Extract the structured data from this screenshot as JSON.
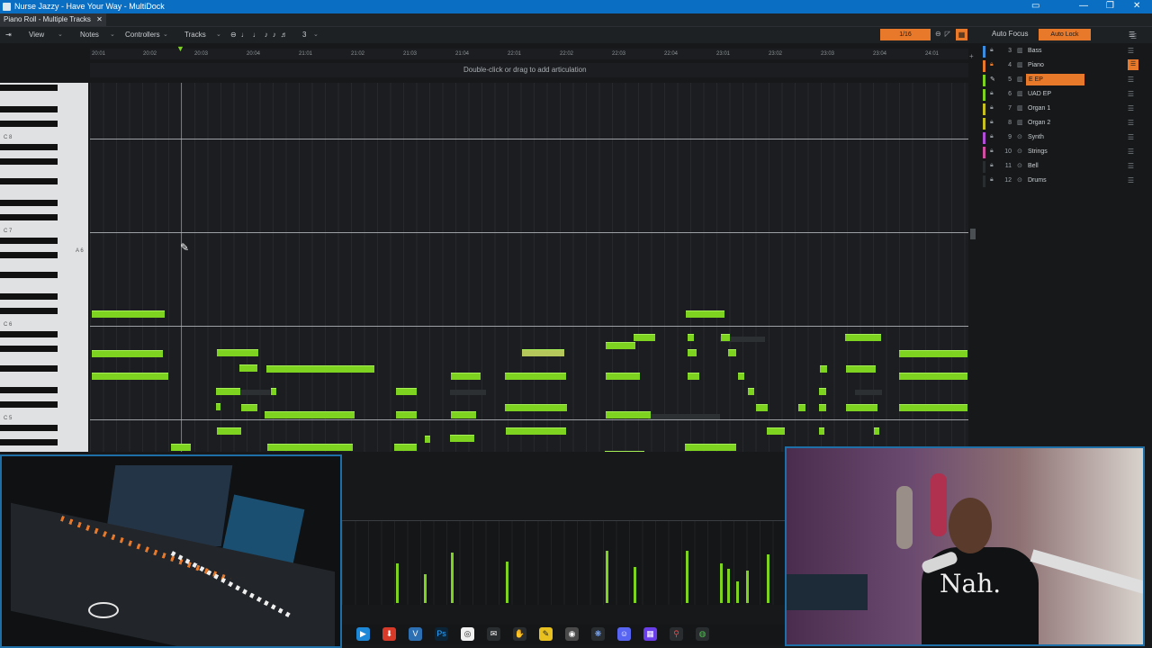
{
  "window": {
    "title": "Nurse Jazzy - Have Your Way - MultiDock"
  },
  "tabs": [
    {
      "label": "Piano Roll - Multiple Tracks"
    }
  ],
  "toolbar": {
    "view": "View",
    "notes": "Notes",
    "controllers": "Controllers",
    "tracks": "Tracks",
    "tool_number": "3",
    "snap": "1/16",
    "auto_focus": "Auto Focus",
    "auto_lock": "Auto Lock"
  },
  "ruler": {
    "markers": [
      "20:01",
      "20:02",
      "20:03",
      "20:04",
      "21:01",
      "21:02",
      "21:03",
      "21:04",
      "22:01",
      "22:02",
      "22:03",
      "22:04",
      "23:01",
      "23:02",
      "23:03",
      "23:04",
      "24:01"
    ]
  },
  "articulation_hint": "Double-click or drag to add articulation",
  "keyboard": {
    "octave_labels": [
      "C 8",
      "C 7",
      "C 6",
      "C 5"
    ],
    "hover_key": "A 6"
  },
  "track_list": [
    {
      "num": "3",
      "name": "Bass",
      "color": "#3b8de0",
      "icon": "instrument-icon"
    },
    {
      "num": "4",
      "name": "Piano",
      "color": "#e8792a",
      "icon": "instrument-icon"
    },
    {
      "num": "5",
      "name": "E EP",
      "color": "#7ed321",
      "icon": "instrument-icon",
      "selected": true
    },
    {
      "num": "6",
      "name": "UAD EP",
      "color": "#7ed321",
      "icon": "instrument-icon"
    },
    {
      "num": "7",
      "name": "Organ 1",
      "color": "#c6c021",
      "icon": "instrument-icon"
    },
    {
      "num": "8",
      "name": "Organ 2",
      "color": "#c6c021",
      "icon": "instrument-icon"
    },
    {
      "num": "9",
      "name": "Synth",
      "color": "#b04ed8",
      "icon": "synth-icon"
    },
    {
      "num": "10",
      "name": "Strings",
      "color": "#d04ea0",
      "icon": "synth-icon"
    },
    {
      "num": "11",
      "name": "Bell",
      "color": "#2a2d30",
      "icon": "synth-icon"
    },
    {
      "num": "12",
      "name": "Drums",
      "color": "#2a2d30",
      "icon": "synth-icon"
    }
  ],
  "taskbar_icons": [
    "store-icon",
    "download-icon",
    "visual-studio-icon",
    "photoshop-icon",
    "capture-icon",
    "mail-icon",
    "touchpad-icon",
    "notes-icon",
    "browser-icon",
    "brain-icon",
    "discord-icon",
    "grid-app-icon",
    "maps-icon",
    "chrome-icon"
  ],
  "webcam_shirt_text": "Nah."
}
